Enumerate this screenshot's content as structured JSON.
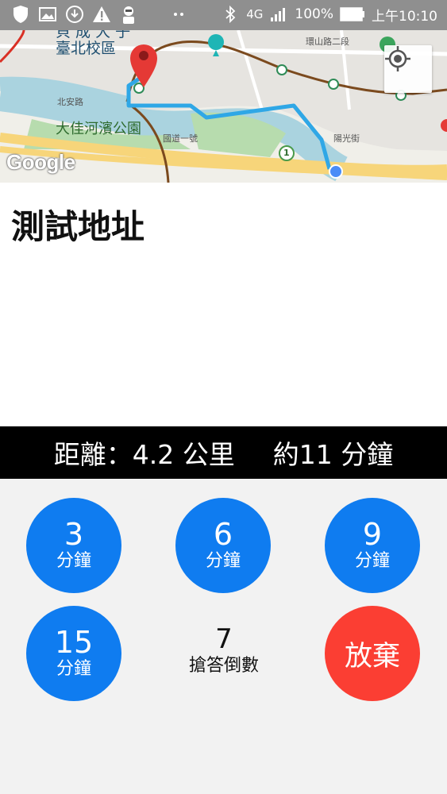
{
  "status_bar": {
    "battery": "100%",
    "time": "上午10:10",
    "network": "4G",
    "icons": [
      "shield-icon",
      "image-icon",
      "download-icon",
      "warning-icon",
      "avatar-icon",
      "more-dots-icon",
      "bluetooth-icon",
      "signal-icon",
      "battery-icon"
    ]
  },
  "map": {
    "labels": {
      "school_top": "臺北校區",
      "school_top_partial": "貝 成 大 子",
      "park": "大佳河濱公園",
      "road_beian": "北安路",
      "road_guodao": "國道一號",
      "road_huanshan": "環山路二段",
      "road_yangguang": "陽光街",
      "marker_one": "1"
    },
    "attribution": "Google",
    "colors": {
      "route": "#2fa7e6",
      "pin": "#e53935",
      "metro": "#7b4a1e"
    }
  },
  "destination": {
    "address": "測試地址"
  },
  "trip": {
    "distance_text": "距離：4.2 公里",
    "eta_text": "約11 分鐘"
  },
  "buttons": {
    "b3": {
      "num": "3",
      "unit": "分鐘"
    },
    "b6": {
      "num": "6",
      "unit": "分鐘"
    },
    "b9": {
      "num": "9",
      "unit": "分鐘"
    },
    "b15": {
      "num": "15",
      "unit": "分鐘"
    },
    "quit": {
      "label": "放棄"
    }
  },
  "countdown": {
    "value": "7",
    "label": "搶答倒數"
  },
  "colors": {
    "blue_button": "#0f7cf0",
    "red_button": "#fb3e33",
    "bar_bg": "#000000"
  }
}
